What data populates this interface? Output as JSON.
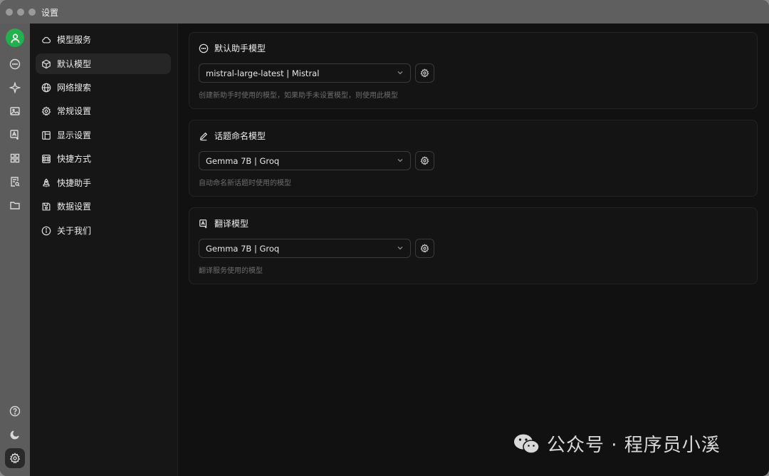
{
  "window": {
    "title": "设置"
  },
  "rail": {
    "items": [
      "user-avatar",
      "chat-icon",
      "sparkle-icon",
      "image-icon",
      "translate-icon",
      "apps-icon",
      "document-search-icon",
      "folder-icon",
      "help-icon",
      "moon-icon",
      "gear-icon"
    ]
  },
  "nav": {
    "items": [
      {
        "label": "模型服务",
        "icon": "cloud-icon"
      },
      {
        "label": "默认模型",
        "icon": "cube-icon"
      },
      {
        "label": "网络搜索",
        "icon": "globe-icon"
      },
      {
        "label": "常规设置",
        "icon": "gear-icon"
      },
      {
        "label": "显示设置",
        "icon": "layout-icon"
      },
      {
        "label": "快捷方式",
        "icon": "command-icon"
      },
      {
        "label": "快捷助手",
        "icon": "rocket-icon"
      },
      {
        "label": "数据设置",
        "icon": "save-icon"
      },
      {
        "label": "关于我们",
        "icon": "info-icon"
      }
    ],
    "active": "默认模型"
  },
  "cards": [
    {
      "title": "默认助手模型",
      "icon": "chat-bubble-icon",
      "value": "mistral-large-latest | Mistral",
      "hint": "创建新助手时使用的模型，如果助手未设置模型，则使用此模型"
    },
    {
      "title": "话题命名模型",
      "icon": "pencil-icon",
      "value": "Gemma 7B | Groq",
      "hint": "自动命名新话题时使用的模型"
    },
    {
      "title": "翻译模型",
      "icon": "translate-icon",
      "value": "Gemma 7B | Groq",
      "hint": "翻译服务使用的模型"
    }
  ],
  "watermark": {
    "text": "公众号 · 程序员小溪"
  },
  "colors": {
    "accent": "#22b14c",
    "background": "#141414",
    "rail": "#5c5c5c"
  }
}
